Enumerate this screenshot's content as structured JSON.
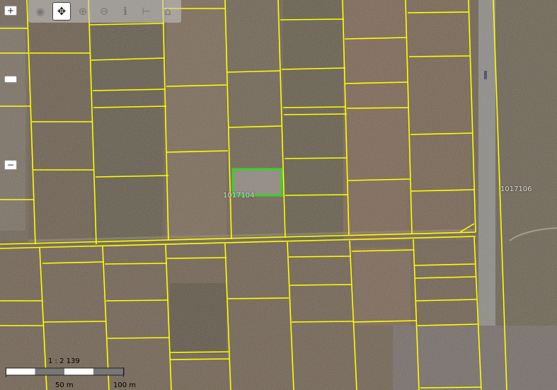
{
  "map": {
    "selected_parcel_label": "1017104",
    "neighbor_parcel_label": "1017106",
    "boundary_color": "#ffff00",
    "selection_color": "#3ecf2c"
  },
  "toolbar": {
    "tools": [
      {
        "name": "globe-icon",
        "glyph": "◉"
      },
      {
        "name": "pan-icon",
        "glyph": "✥"
      },
      {
        "name": "zoom-in-icon",
        "glyph": "⊕"
      },
      {
        "name": "zoom-out-icon",
        "glyph": "⊖"
      },
      {
        "name": "info-icon",
        "glyph": "ℹ"
      },
      {
        "name": "measure-icon",
        "glyph": "⊢"
      },
      {
        "name": "area-icon",
        "glyph": "⌂"
      }
    ],
    "active_tool": "pan-icon"
  },
  "zoom": {
    "in_label": "+",
    "mid_label": "",
    "out_label": "−"
  },
  "scale": {
    "ratio": "1 : 2 139",
    "label_50": "50 m",
    "label_100": "100 m"
  }
}
